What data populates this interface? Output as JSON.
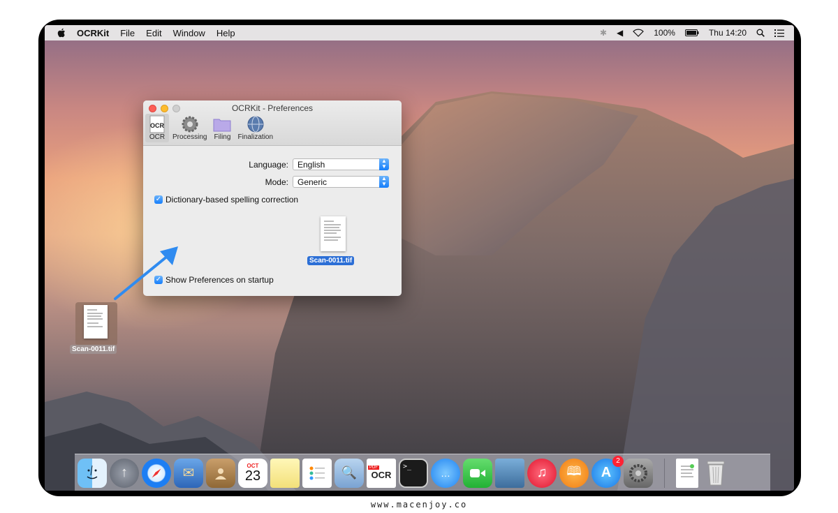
{
  "menubar": {
    "app_name": "OCRKit",
    "menus": [
      "File",
      "Edit",
      "Window",
      "Help"
    ],
    "battery": "100%",
    "clock": "Thu 14:20"
  },
  "window": {
    "title": "OCRKit - Preferences",
    "toolbar": [
      {
        "label": "OCR",
        "icon": "ocr-icon",
        "selected": true
      },
      {
        "label": "Processing",
        "icon": "gear-icon",
        "selected": false
      },
      {
        "label": "Filing",
        "icon": "folder-icon",
        "selected": false
      },
      {
        "label": "Finalization",
        "icon": "globe-icon",
        "selected": false
      }
    ],
    "language_label": "Language:",
    "language_value": "English",
    "mode_label": "Mode:",
    "mode_value": "Generic",
    "spelling_label": "Dictionary-based spelling correction",
    "spelling_checked": true,
    "dragged_file": "Scan-0011.tif",
    "startup_label": "Show Preferences on startup",
    "startup_checked": true
  },
  "desktop": {
    "file_label": "Scan-0011.tif"
  },
  "dock": {
    "apps": [
      "Finder",
      "Launchpad",
      "Safari",
      "Mail",
      "Contacts",
      "Calendar",
      "Notes",
      "Reminders",
      "Preview",
      "OCRKit",
      "Terminal",
      "Messages",
      "FaceTime",
      "iPhoto",
      "iTunes",
      "iBooks",
      "App Store",
      "System Preferences",
      "Document",
      "Trash"
    ],
    "calendar_month": "OCT",
    "calendar_day": "23",
    "ocr_label": "OCR",
    "pdf_label": "PDF",
    "terminal_prompt": ">_",
    "appstore_badge": "2"
  },
  "footer": "www.macenjoy.co"
}
